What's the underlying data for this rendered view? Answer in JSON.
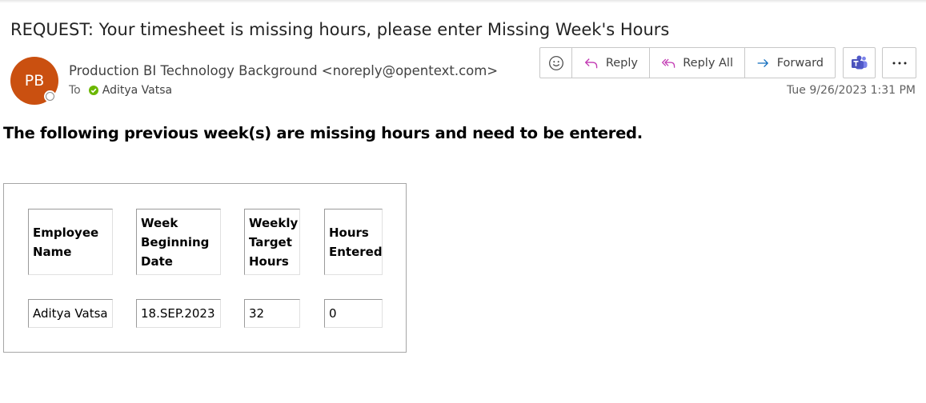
{
  "email": {
    "subject": "REQUEST: Your timesheet is missing hours, please enter Missing Week's Hours",
    "avatar_initials": "PB",
    "avatar_color": "#ca5010",
    "sender": "Production BI Technology Background <noreply@opentext.com>",
    "to_label": "To",
    "to_name": "Aditya Vatsa",
    "date": "Tue 9/26/2023 1:31 PM"
  },
  "toolbar": {
    "reply_label": "Reply",
    "reply_all_label": "Reply All",
    "forward_label": "Forward",
    "icons": [
      "emoji-icon",
      "reply-icon",
      "reply-all-icon",
      "forward-icon",
      "teams-icon",
      "more-icon"
    ]
  },
  "body": {
    "heading": "The following previous week(s) are missing hours and need to be entered.",
    "table": {
      "headers": [
        "Employee Name",
        "Week Beginning Date",
        "Weekly Target Hours",
        "Hours Entered"
      ],
      "rows": [
        [
          "Aditya Vatsa",
          "18.SEP.2023",
          "32",
          "0"
        ]
      ]
    }
  }
}
